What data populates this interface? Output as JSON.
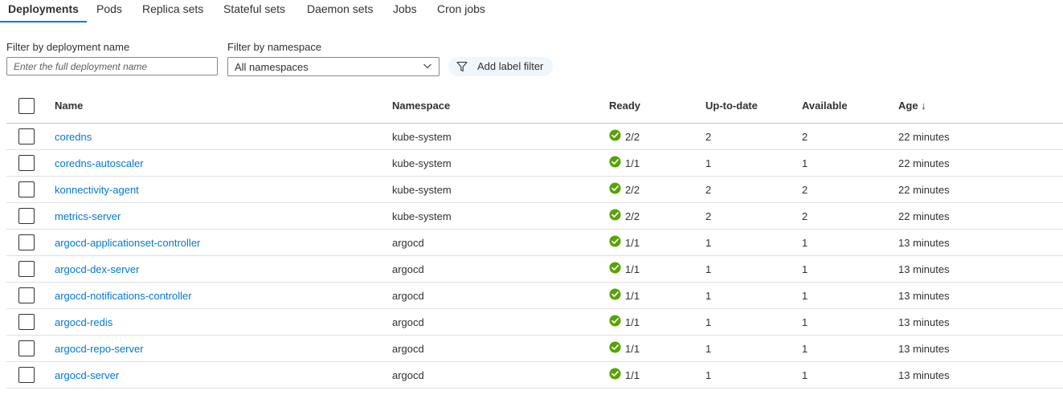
{
  "tabs": [
    {
      "label": "Deployments",
      "active": true
    },
    {
      "label": "Pods"
    },
    {
      "label": "Replica sets"
    },
    {
      "label": "Stateful sets"
    },
    {
      "label": "Daemon sets"
    },
    {
      "label": "Jobs"
    },
    {
      "label": "Cron jobs"
    }
  ],
  "filters": {
    "name_label": "Filter by deployment name",
    "name_placeholder": "Enter the full deployment name",
    "name_value": "",
    "namespace_label": "Filter by namespace",
    "namespace_value": "All namespaces",
    "label_filter_button": "Add label filter"
  },
  "table": {
    "columns": [
      "Name",
      "Namespace",
      "Ready",
      "Up-to-date",
      "Available",
      "Age ↓"
    ],
    "rows": [
      {
        "name": "coredns",
        "namespace": "kube-system",
        "ready": "2/2",
        "up_to_date": "2",
        "available": "2",
        "age": "22 minutes"
      },
      {
        "name": "coredns-autoscaler",
        "namespace": "kube-system",
        "ready": "1/1",
        "up_to_date": "1",
        "available": "1",
        "age": "22 minutes"
      },
      {
        "name": "konnectivity-agent",
        "namespace": "kube-system",
        "ready": "2/2",
        "up_to_date": "2",
        "available": "2",
        "age": "22 minutes"
      },
      {
        "name": "metrics-server",
        "namespace": "kube-system",
        "ready": "2/2",
        "up_to_date": "2",
        "available": "2",
        "age": "22 minutes"
      },
      {
        "name": "argocd-applicationset-controller",
        "namespace": "argocd",
        "ready": "1/1",
        "up_to_date": "1",
        "available": "1",
        "age": "13 minutes"
      },
      {
        "name": "argocd-dex-server",
        "namespace": "argocd",
        "ready": "1/1",
        "up_to_date": "1",
        "available": "1",
        "age": "13 minutes"
      },
      {
        "name": "argocd-notifications-controller",
        "namespace": "argocd",
        "ready": "1/1",
        "up_to_date": "1",
        "available": "1",
        "age": "13 minutes"
      },
      {
        "name": "argocd-redis",
        "namespace": "argocd",
        "ready": "1/1",
        "up_to_date": "1",
        "available": "1",
        "age": "13 minutes"
      },
      {
        "name": "argocd-repo-server",
        "namespace": "argocd",
        "ready": "1/1",
        "up_to_date": "1",
        "available": "1",
        "age": "13 minutes"
      },
      {
        "name": "argocd-server",
        "namespace": "argocd",
        "ready": "1/1",
        "up_to_date": "1",
        "available": "1",
        "age": "13 minutes"
      }
    ]
  },
  "icons": {
    "ready_status": "success-check-icon",
    "label_filter": "filter-funnel-icon",
    "namespace_dropdown": "chevron-down-icon"
  },
  "colors": {
    "accent": "#0078d4",
    "success": "#57a300",
    "label_filter_bg": "#eff6fc"
  }
}
